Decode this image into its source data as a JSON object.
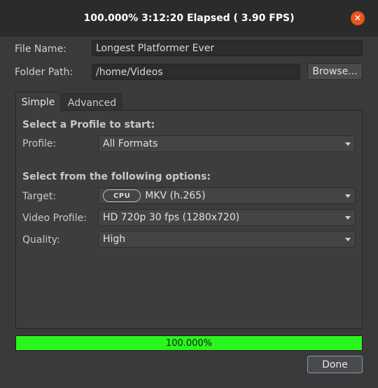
{
  "window": {
    "title": "100.000%  3:12:20 Elapsed ( 3.90 FPS)",
    "close_icon": "close-icon"
  },
  "form": {
    "file_name_label": "File Name:",
    "file_name_value": "Longest Platformer Ever",
    "folder_path_label": "Folder Path:",
    "folder_path_value": "/home/Videos",
    "browse_label": "Browse..."
  },
  "tabs": [
    {
      "label": "Simple",
      "active": true
    },
    {
      "label": "Advanced",
      "active": false
    }
  ],
  "simple": {
    "profile_heading": "Select a Profile to start:",
    "profile_label": "Profile:",
    "profile_value": "All Formats",
    "options_heading": "Select from the following options:",
    "target_label": "Target:",
    "target_badge": "CPU",
    "target_value": "MKV (h.265)",
    "video_profile_label": "Video Profile:",
    "video_profile_value": "HD 720p 30 fps (1280x720)",
    "quality_label": "Quality:",
    "quality_value": "High"
  },
  "progress": {
    "percent": 100,
    "text": "100.000%",
    "color": "#2af51e"
  },
  "done_label": "Done",
  "colors": {
    "close": "#e95420",
    "background": "#3a3a3a"
  }
}
